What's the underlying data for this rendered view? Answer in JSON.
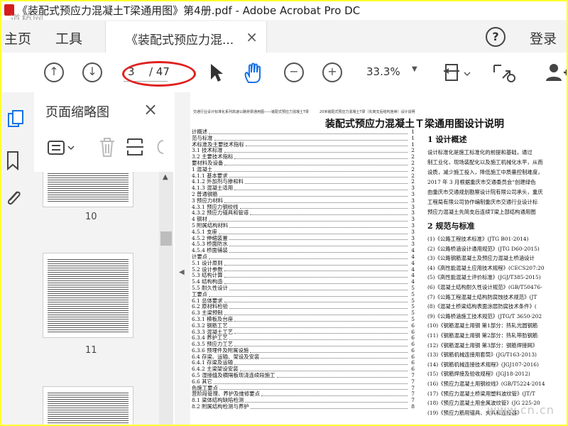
{
  "window": {
    "title": "《装配式预应力混凝土T梁通用图》第4册.pdf - Adobe Acrobat Pro DC",
    "watermark": "道桥网"
  },
  "tabs": {
    "home": "主页",
    "tools": "工具",
    "doc": "《装配式预应力混...",
    "close": "×"
  },
  "header": {
    "help": "?",
    "signin": "登录"
  },
  "toolbar": {
    "page_current": "3",
    "page_total": "/ 47",
    "zoom": "33.3%"
  },
  "thumbnails": {
    "title": "页面缩略图",
    "close": "×",
    "pages": [
      "10",
      "11"
    ]
  },
  "document": {
    "running_header": "交通行业设计标准化系列高速公路桥梁通用图——装配式预应力混凝土T梁　　　20米装配式预应力混凝土T梁（先简支后结构连续）设计说明",
    "title": "装配式预应力混凝土Ｔ梁通用图设计说明",
    "toc": [
      {
        "t": "计概述",
        "p": "1"
      },
      {
        "t": "范与标准",
        "p": "1"
      },
      {
        "t": "术标准及主要技术指标",
        "p": "1"
      },
      {
        "t": "3.1 技术标准",
        "p": "2"
      },
      {
        "t": "3.2 主要技术指标",
        "p": "2"
      },
      {
        "t": "要材料及设备",
        "p": "2"
      },
      {
        "t": "1 混凝土",
        "p": "2"
      },
      {
        "t": "4.1.1 基本要求",
        "p": "2"
      },
      {
        "t": "4.1.2 外加剂与掺和料",
        "p": "2"
      },
      {
        "t": "4.1.3 混凝土适用",
        "p": "3"
      },
      {
        "t": "2 普通钢筋",
        "p": "3"
      },
      {
        "t": "3 预应力材料",
        "p": "3"
      },
      {
        "t": "4.3.1 预应力钢绞线",
        "p": "3"
      },
      {
        "t": "4.3.2 预应力锚具和管道",
        "p": "3"
      },
      {
        "t": "4 钢材",
        "p": "3"
      },
      {
        "t": "5 附属结构材料",
        "p": "3"
      },
      {
        "t": "4.5.1 支座",
        "p": "3"
      },
      {
        "t": "4.5.2 伸缩装置",
        "p": "3"
      },
      {
        "t": "4.5.3 桥面防水",
        "p": "3"
      },
      {
        "t": "4.5.4 桥面铺装",
        "p": "4"
      },
      {
        "t": "计要点",
        "p": "4"
      },
      {
        "t": "5.1 设计原则",
        "p": "4"
      },
      {
        "t": "5.2 设计参数",
        "p": "4"
      },
      {
        "t": "5.3 结构计算",
        "p": "4"
      },
      {
        "t": "5.4 结构构造",
        "p": "4"
      },
      {
        "t": "5.5 耐久性设计",
        "p": "5"
      },
      {
        "t": "工要点",
        "p": "5"
      },
      {
        "t": "6.1 总体要求",
        "p": "5"
      },
      {
        "t": "6.2 原材料检验",
        "p": "5"
      },
      {
        "t": "6.3 主梁预制",
        "p": "5"
      },
      {
        "t": "6.3.1 模板及台座",
        "p": "5"
      },
      {
        "t": "6.3.2 钢筋工艺",
        "p": "6"
      },
      {
        "t": "6.3.3 混凝土工艺",
        "p": "6"
      },
      {
        "t": "6.3.4 养护工艺",
        "p": "6"
      },
      {
        "t": "6.3.5 预应力工艺",
        "p": "6"
      },
      {
        "t": "6.3.6 预埋件及附属设施",
        "p": "6"
      },
      {
        "t": "6.4 存梁、运输、架设及安装",
        "p": "6"
      },
      {
        "t": "6.4.1 存梁及运输",
        "p": "6"
      },
      {
        "t": "6.4.2 主梁架设安装",
        "p": "6"
      },
      {
        "t": "6.5 湿接缝及横隔板现浇连续段施工",
        "p": "7"
      },
      {
        "t": "6.6 其它",
        "p": "7"
      },
      {
        "t": "色施工要点",
        "p": "7"
      },
      {
        "t": "营阶段管理、养护及维修要点",
        "p": "7"
      },
      {
        "t": "8.1 梁体结构缺陷检测",
        "p": "7"
      },
      {
        "t": "8.2 附属结构检测与养护",
        "p": "8"
      }
    ],
    "sections": {
      "s1": "1 设计概述",
      "s2": "2 规范与标准"
    },
    "para1": [
      "设计标准化是施工标准化的前提和基础，通过",
      "制工业化，现场装配化以及施工机械化水平，从而",
      "设质，减少施工投入，降低施工中质量控制难度，",
      "2017 年 3 月根据重庆市交通委员会“创建绿色",
      "由重庆市交通规划勘察设计院有限公司承头，重庆",
      "工程局有限公司协作编制重庆市交通行业设计标",
      "预应力混凝土先简支后连续T梁上部结构通用图"
    ],
    "refs": [
      "(1)《公路工程技术标准》(JTG B01-2014)",
      "(2)《公路桥涵设计通用规范》(JTG D60-2015)",
      "(3)《公路钢筋混凝土及预应力混凝土桥涵设计",
      "(4)《高性能混凝土应用技术规程》(CECS207:20",
      "(5)《高性能混凝土评价标准》(JGJ/T385-2015)",
      "(6)《混凝土结构耐久性设计规范》(GB/T50476-",
      "(7)《公路工程混凝土结构防腐蚀技术规范》(JT",
      "(8)《混凝土桥梁结构表面涂层防腐技术条件》(",
      "(9)《公路桥涵施工技术规范》(JTG/T 3650-202",
      "(10)《钢筋混凝土用钢 第1部分：热轧光圆钢筋",
      "(11)《钢筋混凝土用钢 第2部分：热轧带肋钢筋",
      "(12)《钢筋混凝土用钢 第3部分：钢筋焊接网》",
      "(13)《钢筋机械连接用套筒》(JG/T163-2013)",
      "(14)《钢筋机械连接技术规程》(JGJ107-2016)",
      "(15)《钢筋焊接及验收规程》(JGJ18-2012)",
      "(16)《预应力混凝土用钢绞线》(GB/T5224-2014",
      "(17)《预应力混凝土桥梁用塑料波纹管》(JT/T",
      "(18)《预应力混凝土用金属波纹管》(JG 225-20",
      "(19)《预应力筋用锚具、夹具和连接器》"
    ],
    "watermark": "www.cn.cn"
  }
}
